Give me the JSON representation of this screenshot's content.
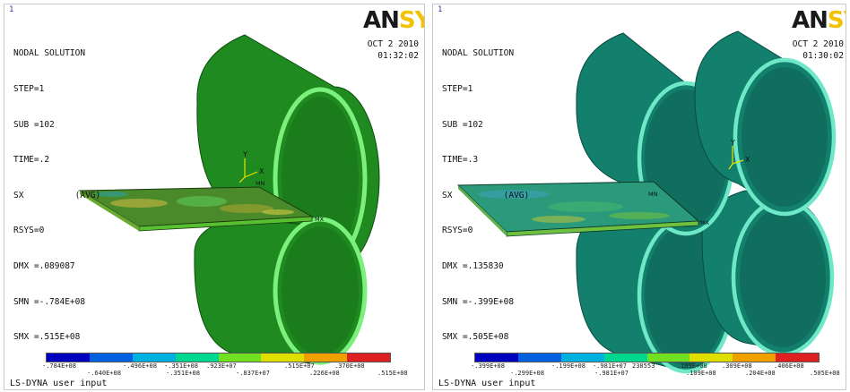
{
  "left": {
    "window_number": "1",
    "info_lines": [
      "NODAL SOLUTION",
      "STEP=1",
      "SUB =102",
      "TIME=.2",
      "SX          (AVG)",
      "RSYS=0",
      "DMX =.089087",
      "SMN =-.784E+08",
      "SMX =.515E+08"
    ],
    "date": "OCT  2 2010",
    "time": "01:32:02",
    "logo_dark": "AN",
    "logo_yellow": "SYS",
    "axis_y": "Y",
    "axis_x": "X",
    "mn_label": "MN",
    "mx_label": "MX",
    "legend_top": [
      "-.784E+08",
      "-.496E+08",
      "-.351E+08",
      ".923E+07",
      ".515E+07",
      ".370E+08"
    ],
    "legend_bottom": [
      "-.640E+08",
      "-.351E+08",
      "-.837E+07",
      ".226E+08",
      ".515E+08"
    ],
    "footer": "LS-DYNA user input"
  },
  "right": {
    "window_number": "1",
    "info_lines": [
      "NODAL SOLUTION",
      "STEP=1",
      "SUB =102",
      "TIME=.3",
      "SX          (AVG)",
      "RSYS=0",
      "DMX =.135830",
      "SMN =-.399E+08",
      "SMX =.505E+08"
    ],
    "date": "OCT  2 2010",
    "time": "01:30:02",
    "logo_dark": "AN",
    "logo_yellow": "SYS",
    "axis_y": "Y",
    "axis_x": "X",
    "mn_label": "MN",
    "mx_label": "MX",
    "legend_top": [
      "-.399E+08",
      "-.199E+08",
      "-.981E+07",
      "238553",
      ".109E+08",
      ".309E+08",
      ".406E+08"
    ],
    "legend_bottom": [
      "-.299E+08",
      "-.981E+07",
      ".109E+08",
      ".204E+08",
      ".505E+08"
    ],
    "footer": "LS-DYNA user input"
  },
  "colors": {
    "roller_left": "#1f8a1f",
    "roller_right": "#13806e",
    "ring_left": "#7cf07c",
    "ring_right": "#6fe8c8",
    "legend_scale": [
      "#0000c0",
      "#0060e0",
      "#00b0e0",
      "#00d890",
      "#70e020",
      "#e0e000",
      "#f0a000",
      "#e02020"
    ]
  }
}
